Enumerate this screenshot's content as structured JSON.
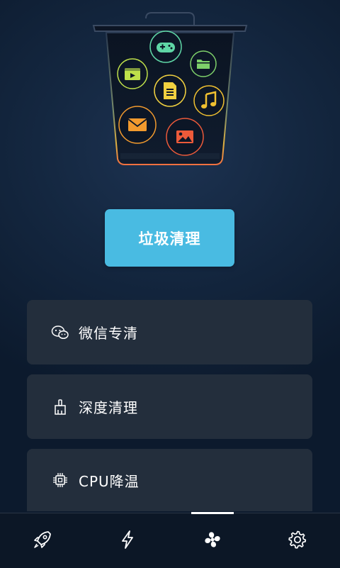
{
  "main_button": {
    "label": "垃圾清理"
  },
  "features": [
    {
      "label": "微信专清",
      "icon": "wechat-icon"
    },
    {
      "label": "深度清理",
      "icon": "brush-icon"
    },
    {
      "label": "CPU降温",
      "icon": "cpu-chip-icon"
    }
  ],
  "tabbar": {
    "active_index": 2,
    "tabs": [
      {
        "icon": "rocket-icon"
      },
      {
        "icon": "lightning-icon"
      },
      {
        "icon": "fan-icon"
      },
      {
        "icon": "gear-icon"
      }
    ]
  },
  "hero": {
    "icons": [
      "gamepad-icon",
      "folder-icon",
      "video-icon",
      "document-icon",
      "music-icon",
      "mail-icon",
      "image-icon"
    ]
  },
  "colors": {
    "accent": "#49bbe2",
    "card": "#232e3c",
    "tabbar": "#0c1726"
  }
}
